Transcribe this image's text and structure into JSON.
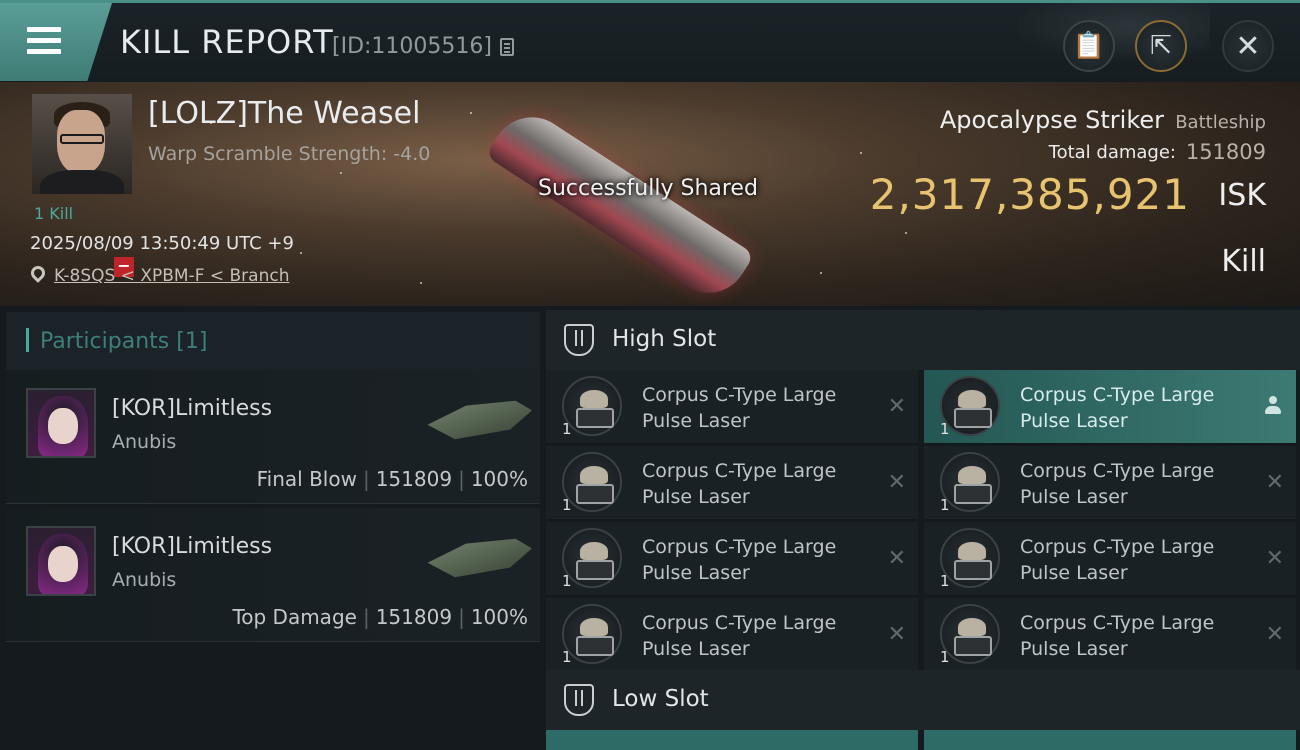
{
  "header": {
    "title": "KILL REPORT",
    "report_id": "[ID:11005516]",
    "icons": [
      "menu-icon",
      "copy-icon",
      "clipboard-icon",
      "share-icon",
      "close-icon"
    ]
  },
  "victim": {
    "name": "[LOLZ]The Weasel",
    "warp_scramble": "Warp Scramble Strength: -4.0",
    "kill_count": "1 Kill",
    "datetime": "2025/08/09 13:50:49 UTC +9",
    "location": "K-8SQS < XPBM-F < Branch",
    "toast": "Successfully Shared"
  },
  "ship": {
    "name": "Apocalypse Striker",
    "class": "Battleship",
    "damage_label": "Total damage:",
    "damage_value": "151809",
    "isk_value": "2,317,385,921",
    "isk_unit": "ISK",
    "kill_type": "Kill"
  },
  "participants": {
    "title": "Participants",
    "count": "[1]",
    "items": [
      {
        "name": "[KOR]Limitless",
        "ship": "Anubis",
        "role": "Final Blow",
        "damage": "151809",
        "percent": "100%"
      },
      {
        "name": "[KOR]Limitless",
        "ship": "Anubis",
        "role": "Top Damage",
        "damage": "151809",
        "percent": "100%"
      }
    ]
  },
  "slots": {
    "high": {
      "title": "High Slot",
      "modules": [
        {
          "line1": "Corpus C-Type Large",
          "line2": "Pulse Laser",
          "qty": "1",
          "status": "destroyed"
        },
        {
          "line1": "Corpus C-Type Large",
          "line2": "Pulse Laser",
          "qty": "1",
          "status": "user"
        },
        {
          "line1": "Corpus C-Type Large",
          "line2": "Pulse Laser",
          "qty": "1",
          "status": "destroyed"
        },
        {
          "line1": "Corpus C-Type Large",
          "line2": "Pulse Laser",
          "qty": "1",
          "status": "destroyed"
        },
        {
          "line1": "Corpus C-Type Large",
          "line2": "Pulse Laser",
          "qty": "1",
          "status": "destroyed"
        },
        {
          "line1": "Corpus C-Type Large",
          "line2": "Pulse Laser",
          "qty": "1",
          "status": "destroyed"
        },
        {
          "line1": "Corpus C-Type Large",
          "line2": "Pulse Laser",
          "qty": "1",
          "status": "destroyed"
        },
        {
          "line1": "Corpus C-Type Large",
          "line2": "Pulse Laser",
          "qty": "1",
          "status": "destroyed"
        }
      ]
    },
    "low": {
      "title": "Low Slot"
    }
  },
  "colors": {
    "accent": "#4aa8a0",
    "isk": "#e8c36f",
    "badge": "#c1232b"
  }
}
